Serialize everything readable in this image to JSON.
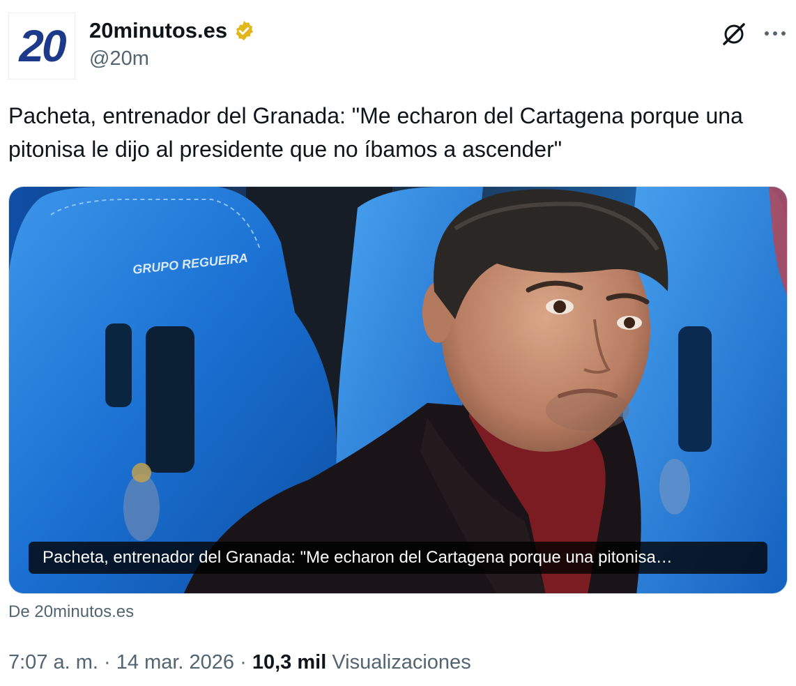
{
  "author": {
    "avatar_text": "20",
    "display_name": "20minutos.es",
    "handle": "@20m",
    "verified_badge_icon": "gold-verified-badge-icon"
  },
  "header_actions": {
    "grok_icon": "grok-icon",
    "more_icon": "more-options-icon"
  },
  "tweet": {
    "text": "Pacheta, entrenador del Granada: \"Me echaron del Cartagena porque una pitonisa le dijo al presidente que no íbamos a ascender\""
  },
  "card": {
    "image_overlay_text": "GRUPO REGUEIRA",
    "caption": "Pacheta, entrenador del Granada: \"Me echaron del Cartagena porque una pitonisa…",
    "source": "De 20minutos.es"
  },
  "meta": {
    "time": "7:07 a. m.",
    "separator": "·",
    "date": "14 mar. 2026",
    "views_count": "10,3 mil",
    "views_label": "Visualizaciones"
  },
  "colors": {
    "text_primary": "#0f1419",
    "text_secondary": "#536471",
    "brand_blue": "#1d3a8a",
    "verified_gold": "#e2b719",
    "seat_blue": "#1a6fd1"
  }
}
